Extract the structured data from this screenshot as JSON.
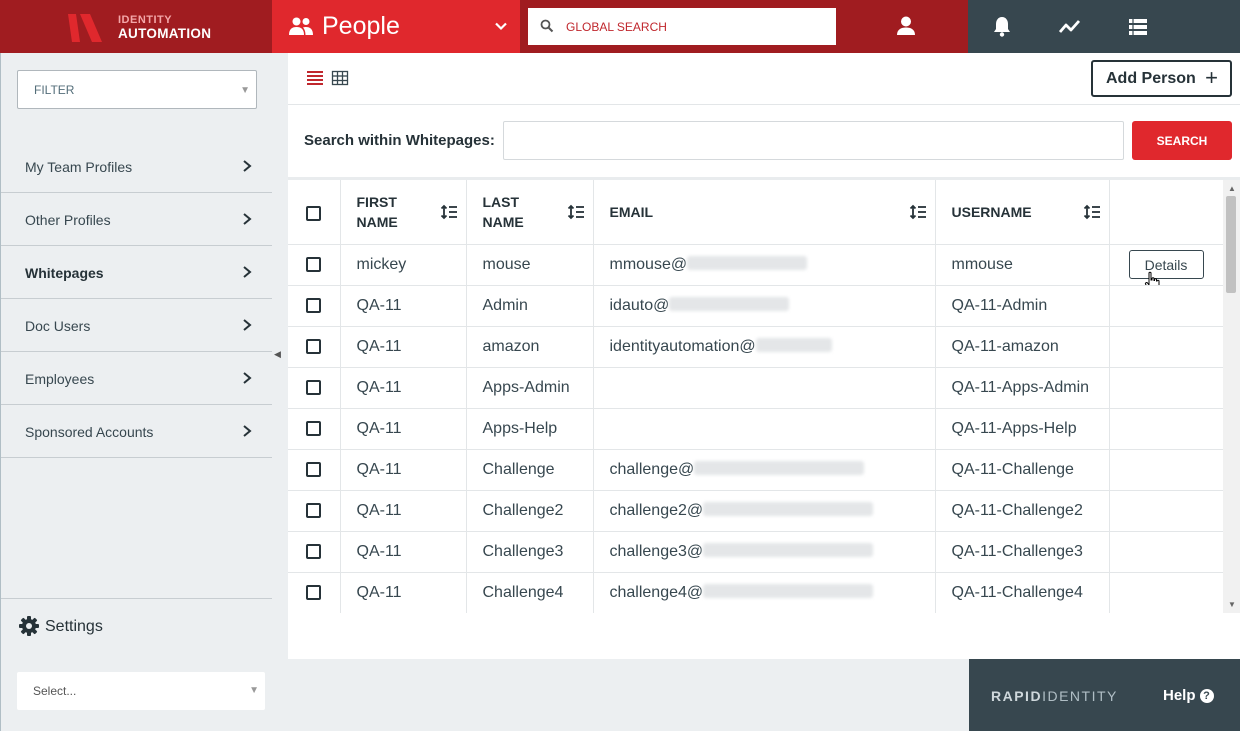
{
  "brand": {
    "logo_line1": "IDENTITY",
    "logo_line2": "AUTOMATION"
  },
  "header": {
    "module_label": "People",
    "search_placeholder": "GLOBAL SEARCH",
    "icons": [
      "people-icon",
      "chevron-down-icon",
      "search-icon",
      "user-icon",
      "bell-icon",
      "activity-icon",
      "list-icon"
    ]
  },
  "sidebar": {
    "filter_label": "FILTER",
    "items": [
      {
        "label": "My Team Profiles",
        "active": false
      },
      {
        "label": "Other Profiles",
        "active": false
      },
      {
        "label": "Whitepages",
        "active": true
      },
      {
        "label": "Doc Users",
        "active": false
      },
      {
        "label": "Employees",
        "active": false
      },
      {
        "label": "Sponsored Accounts",
        "active": false
      }
    ],
    "settings_label": "Settings"
  },
  "toolbar": {
    "add_person_label": "Add Person",
    "add_icon": "+"
  },
  "whitepages_search": {
    "label": "Search within Whitepages:",
    "value": "",
    "button_label": "SEARCH"
  },
  "table": {
    "columns": [
      "FIRST NAME",
      "LAST NAME",
      "EMAIL",
      "USERNAME"
    ],
    "details_label": "Details",
    "rows": [
      {
        "first": "mickey",
        "last": "mouse",
        "email": "mmouse@",
        "email_blur": 120,
        "username": "mmouse",
        "details": true
      },
      {
        "first": "QA-11",
        "last": "Admin",
        "email": "idauto@",
        "email_blur": 120,
        "username": "QA-11-Admin",
        "details": false
      },
      {
        "first": "QA-11",
        "last": "amazon",
        "email": "identityautomation@",
        "email_blur": 76,
        "username": "QA-11-amazon",
        "details": false
      },
      {
        "first": "QA-11",
        "last": "Apps-Admin",
        "email": "",
        "email_blur": 0,
        "username": "QA-11-Apps-Admin",
        "details": false
      },
      {
        "first": "QA-11",
        "last": "Apps-Help",
        "email": "",
        "email_blur": 0,
        "username": "QA-11-Apps-Help",
        "details": false
      },
      {
        "first": "QA-11",
        "last": "Challenge",
        "email": "challenge@",
        "email_blur": 170,
        "username": "QA-11-Challenge",
        "details": false
      },
      {
        "first": "QA-11",
        "last": "Challenge2",
        "email": "challenge2@",
        "email_blur": 170,
        "username": "QA-11-Challenge2",
        "details": false
      },
      {
        "first": "QA-11",
        "last": "Challenge3",
        "email": "challenge3@",
        "email_blur": 170,
        "username": "QA-11-Challenge3",
        "details": false
      },
      {
        "first": "QA-11",
        "last": "Challenge4",
        "email": "challenge4@",
        "email_blur": 170,
        "username": "QA-11-Challenge4",
        "details": false
      }
    ]
  },
  "footer": {
    "select_placeholder": "Select...",
    "brand_bold": "RAPID",
    "brand_light": "IDENTITY",
    "help_label": "Help",
    "help_icon": "?"
  },
  "colors": {
    "red": "#e0282d",
    "dark_red": "#a01c20",
    "slate": "#37474f",
    "sidebar_bg": "#eceff1"
  }
}
